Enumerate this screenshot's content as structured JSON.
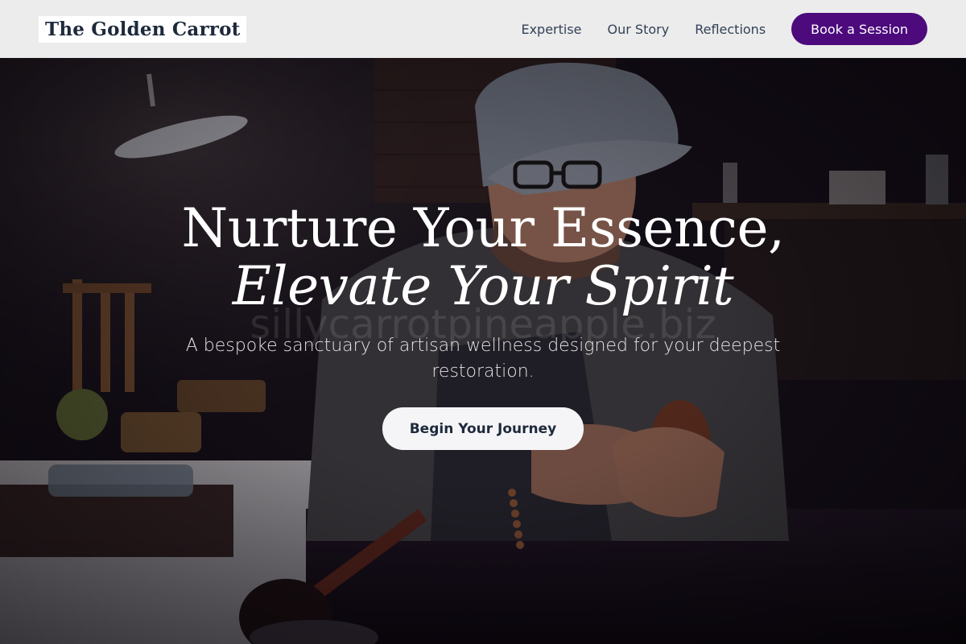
{
  "nav": {
    "brand": "The Golden Carrot",
    "links": [
      "Expertise",
      "Our Story",
      "Reflections"
    ],
    "cta": "Book a Session"
  },
  "hero": {
    "headline_line1": "Nurture Your Essence,",
    "headline_line2": "Elevate Your Spirit",
    "subtitle": "A bespoke sanctuary of artisan wellness designed for your deepest restoration.",
    "button": "Begin Your Journey",
    "watermark": "sillycarrotpineapple.biz"
  },
  "colors": {
    "accent": "#4c0a7d",
    "nav_bg": "#f4f4f5",
    "hero_text": "#ffffff",
    "button_bg": "#f5f5f8"
  }
}
